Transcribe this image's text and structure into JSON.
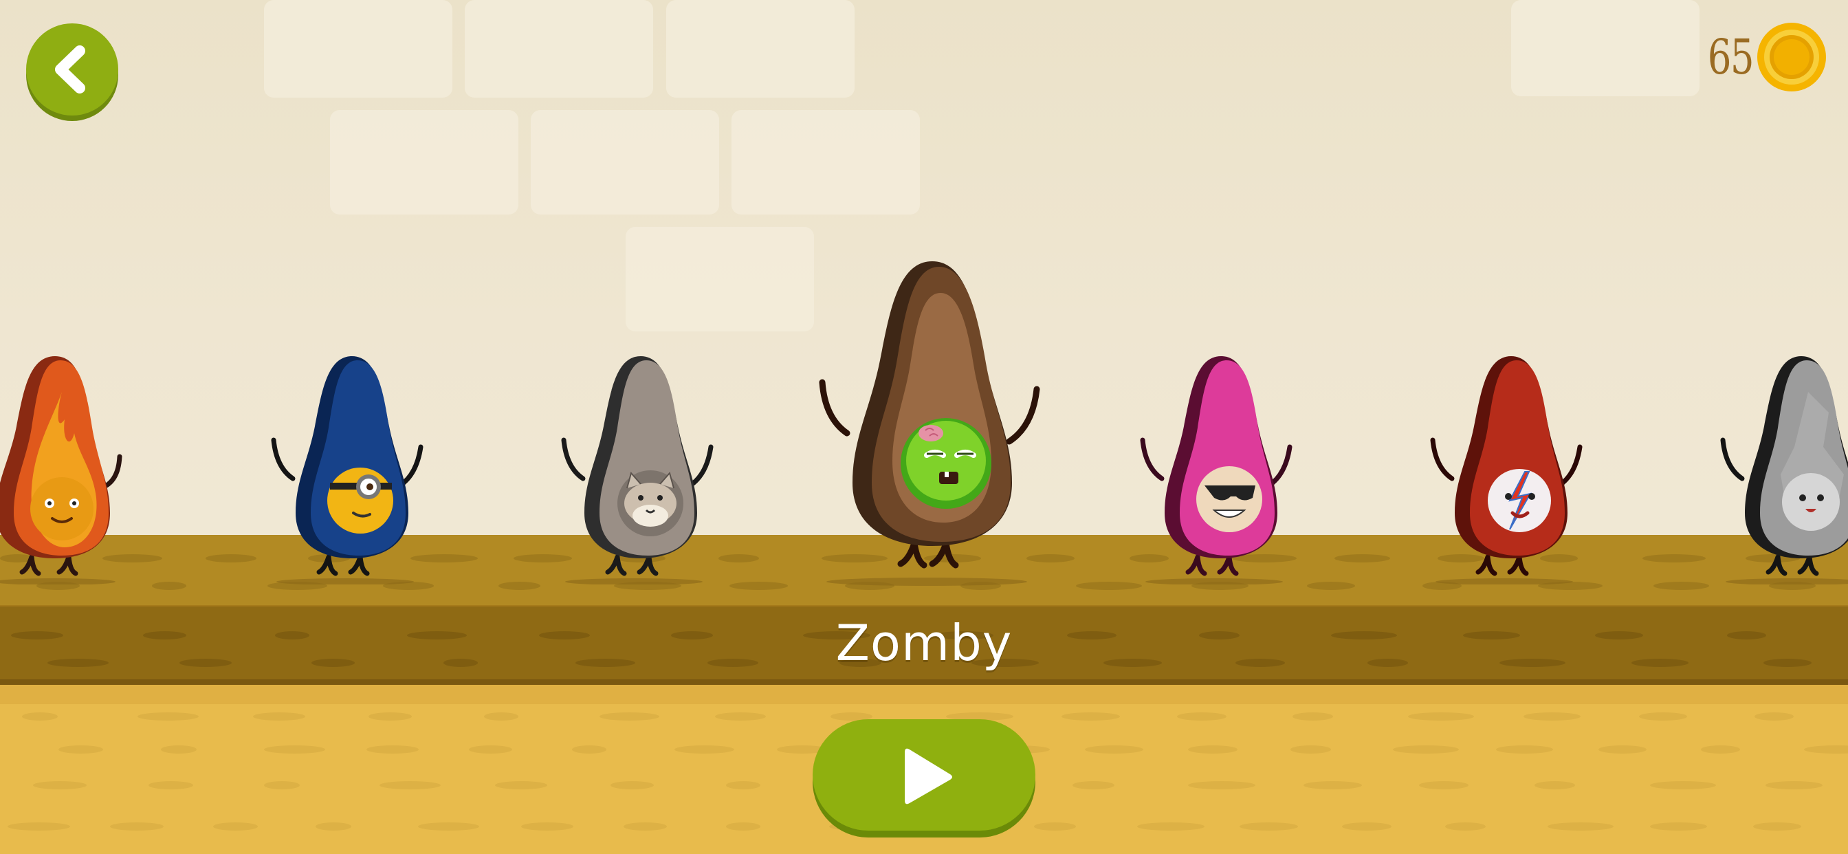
{
  "hud": {
    "coin_count": "65",
    "back_icon": "chevron-left-icon",
    "coin_icon": "coin-icon"
  },
  "selected_character": {
    "name": "Zomby"
  },
  "characters": [
    {
      "skin": "fire",
      "body_color": "#e0591c",
      "selected": false
    },
    {
      "skin": "minion",
      "body_color": "#17428a",
      "selected": false
    },
    {
      "skin": "cat",
      "body_color": "#9a8f86",
      "selected": false
    },
    {
      "skin": "zomby",
      "body_color": "#9a6a44",
      "selected": true
    },
    {
      "skin": "sunglasses",
      "body_color": "#dd3b9a",
      "selected": false
    },
    {
      "skin": "bowie",
      "body_color": "#b62c1a",
      "selected": false
    },
    {
      "skin": "stone",
      "body_color": "#9c9c9c",
      "selected": false
    }
  ],
  "play_button": {
    "icon": "play-icon"
  },
  "colors": {
    "accent_green": "#8fb00f",
    "wall": "#ede4cd",
    "shelf": "#b28a23",
    "floor": "#e8bb4c"
  }
}
